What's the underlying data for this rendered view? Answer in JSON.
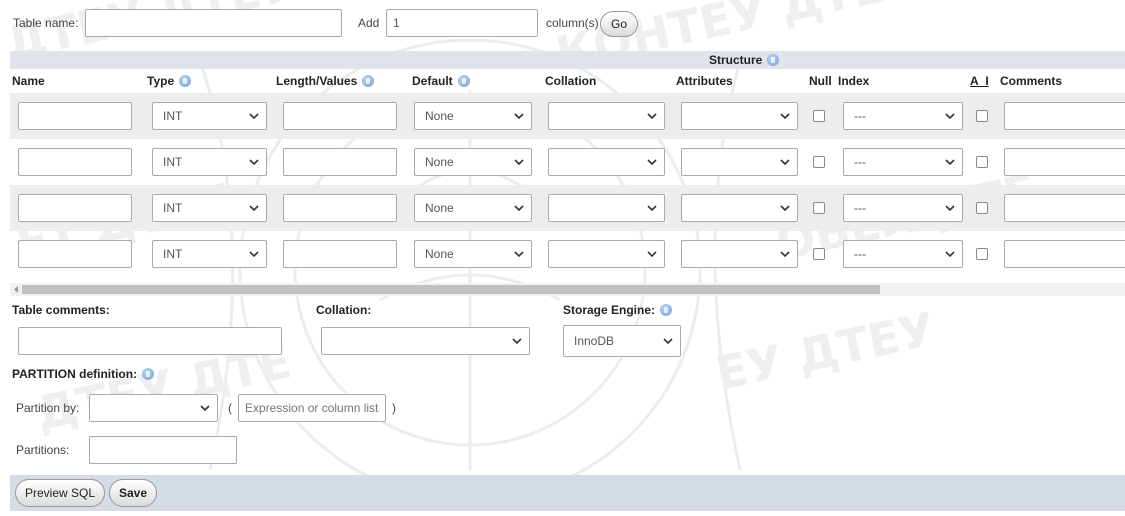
{
  "top": {
    "table_name_label": "Table name:",
    "table_name_value": "",
    "add_label": "Add",
    "add_value": "1",
    "columns_label": "column(s)",
    "go_label": "Go"
  },
  "structure": {
    "label": "Structure",
    "headers": {
      "name": "Name",
      "type": "Type",
      "length": "Length/Values",
      "default": "Default",
      "collation": "Collation",
      "attributes": "Attributes",
      "null": "Null",
      "index": "Index",
      "ai": "A_I",
      "comments": "Comments"
    },
    "rows": [
      {
        "name": "",
        "type": "INT",
        "length": "",
        "default": "None",
        "collation": "",
        "attributes": "",
        "null": false,
        "index": "---",
        "ai": false,
        "comments": ""
      },
      {
        "name": "",
        "type": "INT",
        "length": "",
        "default": "None",
        "collation": "",
        "attributes": "",
        "null": false,
        "index": "---",
        "ai": false,
        "comments": ""
      },
      {
        "name": "",
        "type": "INT",
        "length": "",
        "default": "None",
        "collation": "",
        "attributes": "",
        "null": false,
        "index": "---",
        "ai": false,
        "comments": ""
      },
      {
        "name": "",
        "type": "INT",
        "length": "",
        "default": "None",
        "collation": "",
        "attributes": "",
        "null": false,
        "index": "---",
        "ai": false,
        "comments": ""
      }
    ]
  },
  "table_options": {
    "comments_label": "Table comments:",
    "comments_value": "",
    "collation_label": "Collation:",
    "collation_value": "",
    "engine_label": "Storage Engine:",
    "engine_value": "InnoDB"
  },
  "partition": {
    "title": "PARTITION definition:",
    "by_label": "Partition by:",
    "by_value": "",
    "open_paren": "(",
    "expression_placeholder": "Expression or column list",
    "close_paren": ")",
    "partitions_label": "Partitions:",
    "partitions_value": ""
  },
  "footer": {
    "preview_sql_label": "Preview SQL",
    "save_label": "Save"
  },
  "colors": {
    "band": "#dfe3ea",
    "row_alt": "#ededed",
    "footer": "#d5dce6",
    "help_icon": "#6f9fd4"
  }
}
